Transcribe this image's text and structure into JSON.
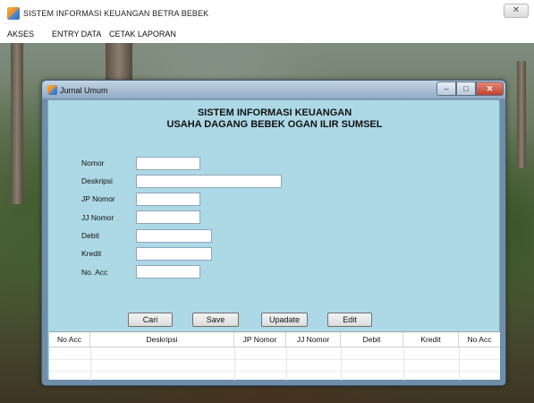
{
  "app": {
    "title": "SISTEM INFORMASI KEUANGAN BETRA BEBEK",
    "close_glyph": "✕"
  },
  "menu": {
    "items": [
      {
        "label": "AKSES"
      },
      {
        "label": "ENTRY DATA"
      },
      {
        "label": "CETAK LAPORAN"
      }
    ]
  },
  "window": {
    "title": "Jurnal Umum",
    "min_glyph": "–",
    "max_glyph": "□",
    "close_glyph": "✕"
  },
  "form": {
    "heading_line1": "SISTEM INFORMASI KEUANGAN",
    "heading_line2": "USAHA DAGANG BEBEK OGAN ILIR SUMSEL",
    "fields": [
      {
        "label": "Nomor",
        "value": ""
      },
      {
        "label": "Deskripsi",
        "value": ""
      },
      {
        "label": "JP Nomor",
        "value": ""
      },
      {
        "label": "JJ Nomor",
        "value": ""
      },
      {
        "label": "Debit",
        "value": ""
      },
      {
        "label": "Kredit",
        "value": ""
      },
      {
        "label": "No. Acc",
        "value": ""
      }
    ]
  },
  "buttons": {
    "cari": "Cari",
    "save": "Save",
    "update": "Upadate",
    "edit": "Edit"
  },
  "grid": {
    "columns": [
      "No Acc",
      "Deskripsi",
      "JP Nomor",
      "JJ Nomor",
      "Debit",
      "Kredit",
      "No Acc"
    ]
  }
}
